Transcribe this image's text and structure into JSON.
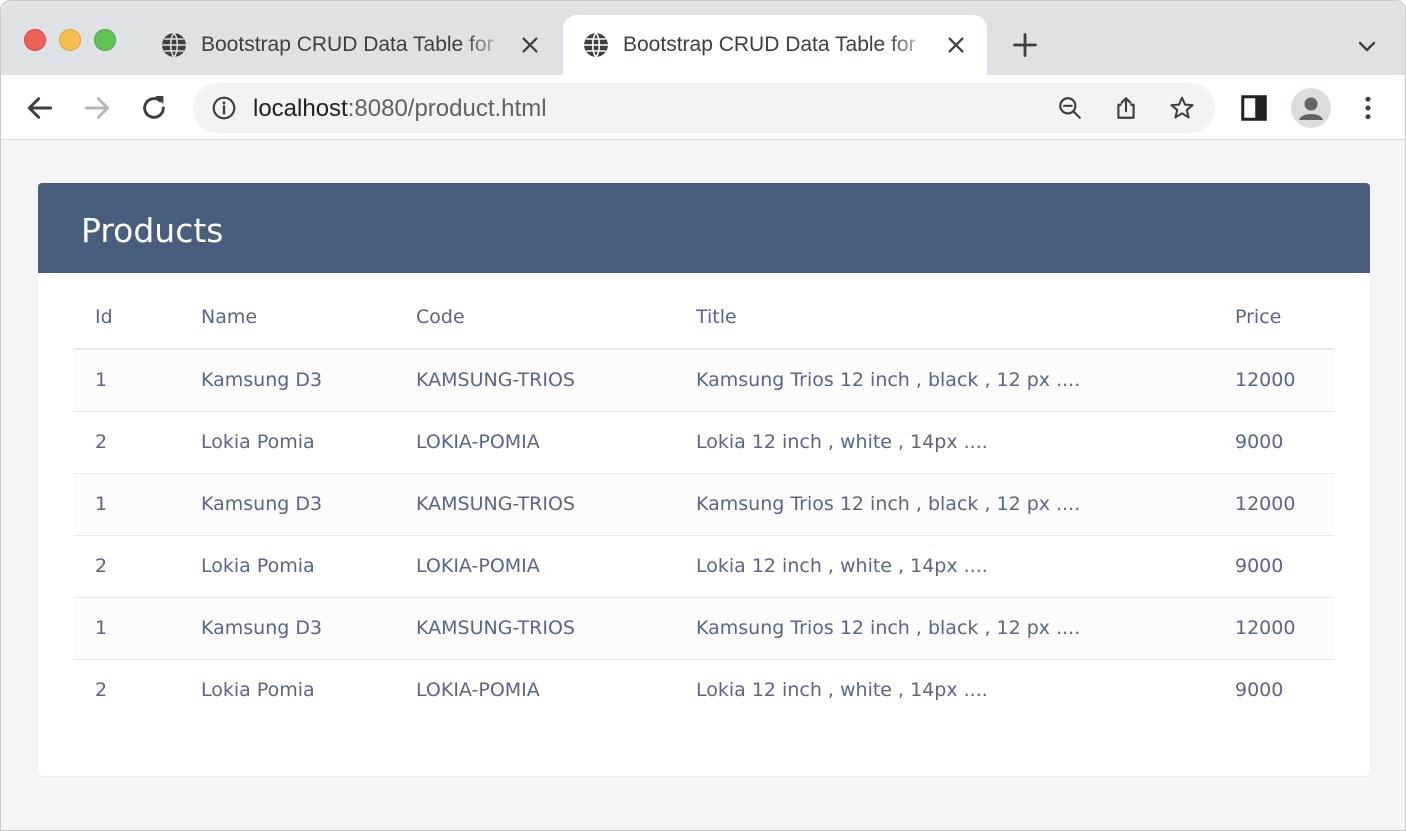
{
  "browser": {
    "tabs": [
      {
        "title": "Bootstrap CRUD Data Table for",
        "active": false
      },
      {
        "title": "Bootstrap CRUD Data Table for",
        "active": true
      }
    ],
    "url_host": "localhost",
    "url_rest": ":8080/product.html"
  },
  "page": {
    "header_color": "#495e7c",
    "title": "Products",
    "table": {
      "columns": [
        "Id",
        "Name",
        "Code",
        "Title",
        "Price"
      ],
      "rows": [
        [
          "1",
          "Kamsung D3",
          "KAMSUNG-TRIOS",
          "Kamsung Trios 12 inch , black , 12 px ....",
          "12000"
        ],
        [
          "2",
          "Lokia Pomia",
          "LOKIA-POMIA",
          "Lokia 12 inch , white , 14px ....",
          "9000"
        ],
        [
          "1",
          "Kamsung D3",
          "KAMSUNG-TRIOS",
          "Kamsung Trios 12 inch , black , 12 px ....",
          "12000"
        ],
        [
          "2",
          "Lokia Pomia",
          "LOKIA-POMIA",
          "Lokia 12 inch , white , 14px ....",
          "9000"
        ],
        [
          "1",
          "Kamsung D3",
          "KAMSUNG-TRIOS",
          "Kamsung Trios 12 inch , black , 12 px ....",
          "12000"
        ],
        [
          "2",
          "Lokia Pomia",
          "LOKIA-POMIA",
          "Lokia 12 inch , white , 14px ....",
          "9000"
        ]
      ]
    }
  }
}
